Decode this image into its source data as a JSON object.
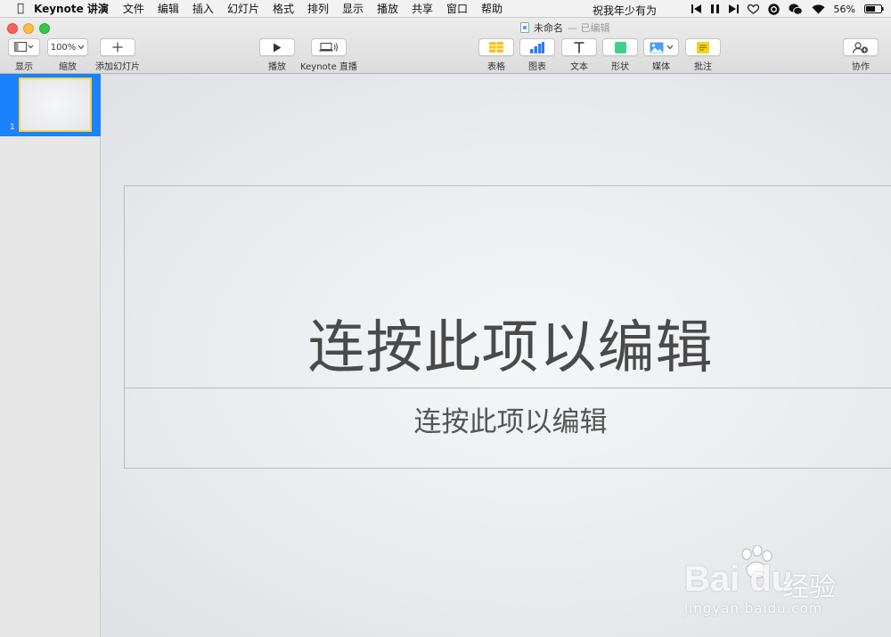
{
  "menubar": {
    "app_name": "Keynote 讲演",
    "menus": [
      "文件",
      "编辑",
      "插入",
      "幻灯片",
      "格式",
      "排列",
      "显示",
      "播放",
      "共享",
      "窗口",
      "帮助"
    ],
    "center_text": "祝我年少有为",
    "battery": "56%"
  },
  "window": {
    "doc_name": "未命名",
    "doc_status": "— 已编辑"
  },
  "toolbar": {
    "view_label": "显示",
    "zoom_value": "100%",
    "zoom_label": "缩放",
    "add_slide_label": "添加幻灯片",
    "play_label": "播放",
    "live_label": "Keynote 直播",
    "table_label": "表格",
    "chart_label": "图表",
    "text_label": "文本",
    "shape_label": "形状",
    "media_label": "媒体",
    "comment_label": "批注",
    "collab_label": "协作"
  },
  "navigator": {
    "slides": [
      {
        "number": "1"
      }
    ]
  },
  "slide": {
    "title": "连按此项以编辑",
    "subtitle": "连按此项以编辑"
  },
  "watermark": {
    "brand": "Bai du",
    "brand_cn": "经验",
    "url": "jingyan.baidu.com"
  },
  "colors": {
    "selection": "#1a82fb",
    "thumb_border": "#f5d547",
    "table_icon": "#f7c31b",
    "chart_icon": "#2f80e6",
    "shape_icon": "#3fcf8e",
    "comment_icon": "#f7d21b"
  }
}
